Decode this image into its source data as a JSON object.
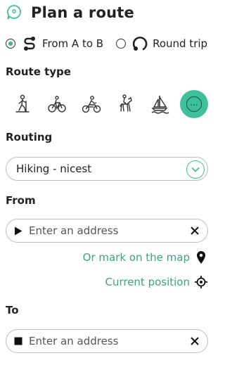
{
  "header": {
    "title": "Plan a route",
    "logo_icon": "chat-pin-icon"
  },
  "mode": {
    "options": [
      {
        "label": "From A to B",
        "icon": "a-to-b-route-icon",
        "selected": true
      },
      {
        "label": "Round trip",
        "icon": "round-trip-icon",
        "selected": false
      }
    ]
  },
  "route_type": {
    "label": "Route type",
    "options": [
      {
        "name": "hiking",
        "icon": "hiking-icon",
        "active": false
      },
      {
        "name": "cycling",
        "icon": "bicycle-icon",
        "active": false
      },
      {
        "name": "motorbike",
        "icon": "motorbike-icon",
        "active": false
      },
      {
        "name": "horse riding",
        "icon": "horse-riding-icon",
        "active": false
      },
      {
        "name": "boating",
        "icon": "sailboat-icon",
        "active": false
      },
      {
        "name": "more",
        "icon": "more-icon",
        "active": true,
        "glyph": "..."
      }
    ]
  },
  "routing": {
    "label": "Routing",
    "value": "Hiking - nicest"
  },
  "from": {
    "label": "From",
    "placeholder": "Enter an address",
    "value": ""
  },
  "links": {
    "mark_on_map": "Or mark on the map",
    "current_position": "Current position"
  },
  "to": {
    "label": "To",
    "placeholder": "Enter an address",
    "value": ""
  },
  "colors": {
    "accent": "#3ec19a",
    "link": "#3aa37f",
    "text": "#222222",
    "border": "#bdbdbd"
  }
}
